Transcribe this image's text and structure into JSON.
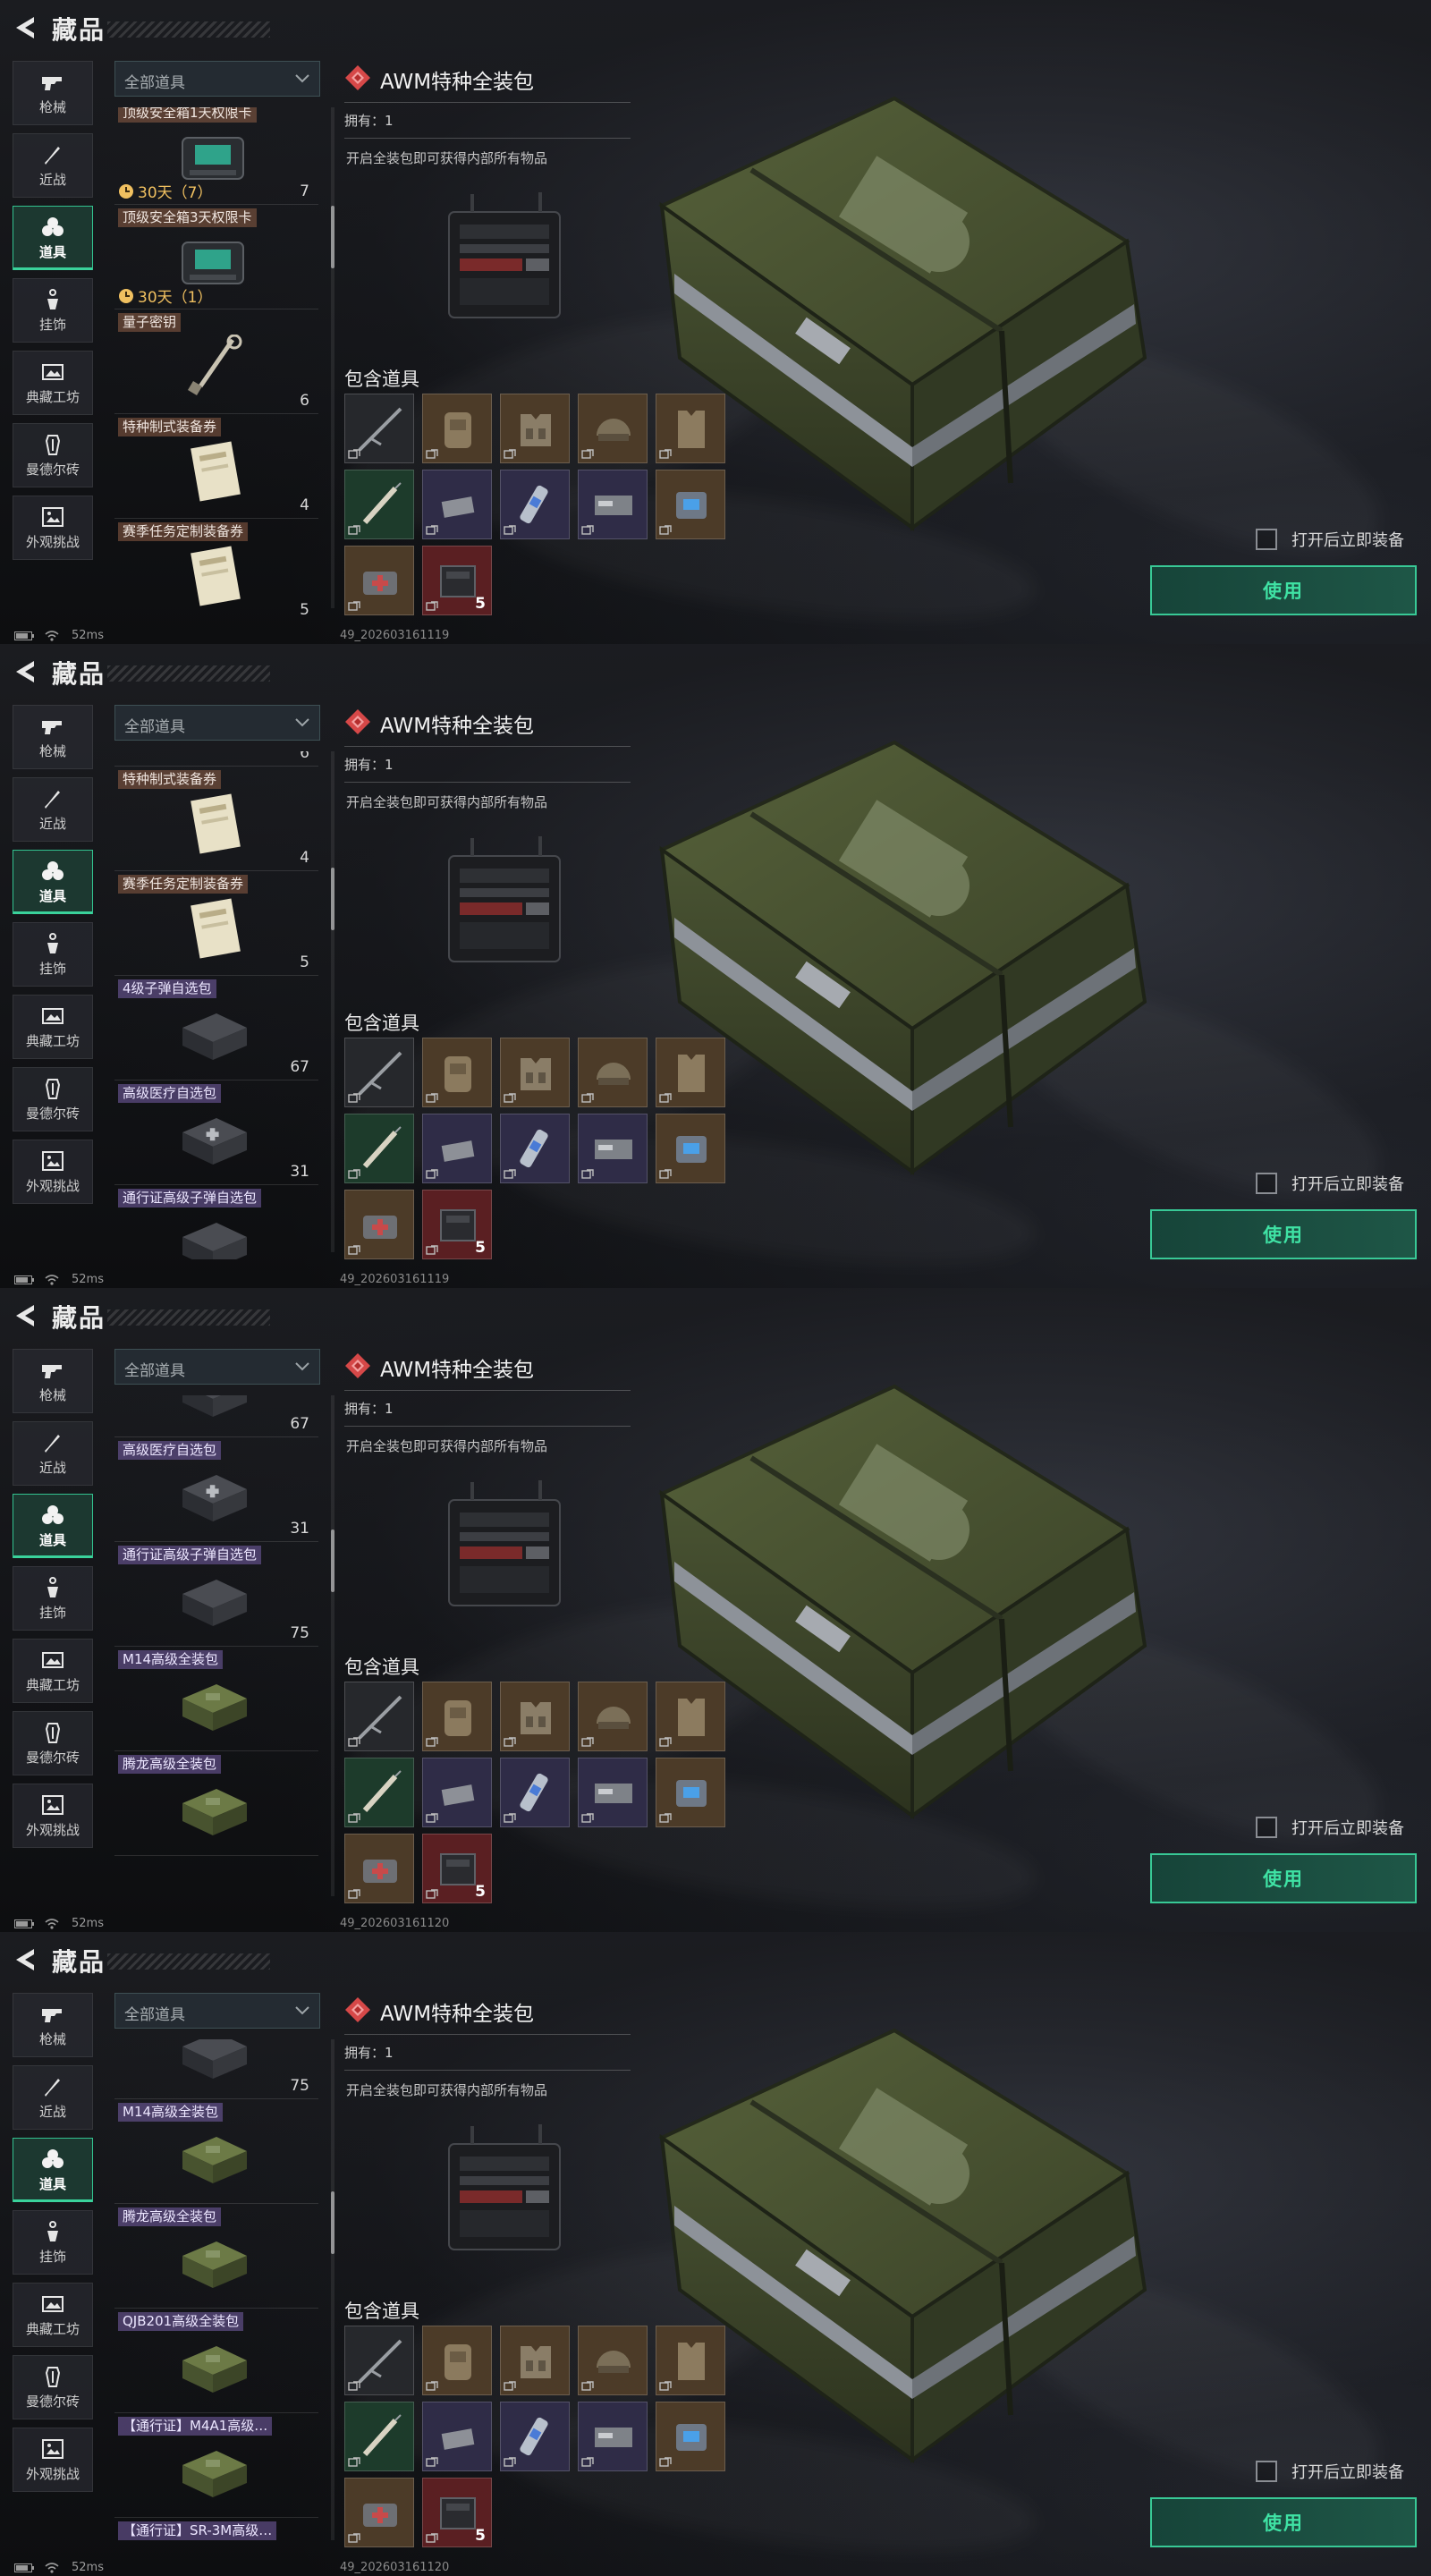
{
  "header": {
    "title": "藏品"
  },
  "nav": [
    {
      "label": "枪械",
      "icon": "gun-icon"
    },
    {
      "label": "近战",
      "icon": "knife-icon"
    },
    {
      "label": "道具",
      "icon": "grenade-icon",
      "active": true
    },
    {
      "label": "挂饰",
      "icon": "charm-icon"
    },
    {
      "label": "典藏工坊",
      "icon": "workshop-icon"
    },
    {
      "label": "曼德尔砖",
      "icon": "brick-icon"
    },
    {
      "label": "外观挑战",
      "icon": "challenge-icon"
    }
  ],
  "filter": {
    "label": "全部道具"
  },
  "detail": {
    "title": "AWM特种全装包",
    "owned": "拥有：1",
    "description": "开启全装包即可获得内部所有物品",
    "contains_title": "包含道具",
    "contained": [
      {
        "name": "sniper-rifle",
        "rarity": "gray",
        "count": ""
      },
      {
        "name": "backpack",
        "rarity": "gold",
        "count": ""
      },
      {
        "name": "chest-rig",
        "rarity": "gold",
        "count": ""
      },
      {
        "name": "helmet",
        "rarity": "gold",
        "count": ""
      },
      {
        "name": "body-armor",
        "rarity": "gold",
        "count": ""
      },
      {
        "name": "syringe",
        "rarity": "green",
        "count": ""
      },
      {
        "name": "ammo-box",
        "rarity": "purple",
        "count": ""
      },
      {
        "name": "injector",
        "rarity": "purple",
        "count": ""
      },
      {
        "name": "keycard",
        "rarity": "purple",
        "count": ""
      },
      {
        "name": "battery",
        "rarity": "gold",
        "count": ""
      },
      {
        "name": "medkit",
        "rarity": "gold",
        "count": ""
      },
      {
        "name": "ammo-crate",
        "rarity": "red",
        "count": "5"
      }
    ]
  },
  "actions": {
    "equip_label": "打开后立即装备",
    "use_label": "使用"
  },
  "status": {
    "ping": "52ms"
  },
  "frames": [
    {
      "build_id": "49_202603161119",
      "list": [
        {
          "name": "顶级安全箱1天权限卡",
          "color": "orange",
          "timer": "30天（7）",
          "count": "7",
          "art": "case"
        },
        {
          "name": "顶级安全箱3天权限卡",
          "color": "orange",
          "timer": "30天（1）",
          "count": "",
          "art": "case"
        },
        {
          "name": "量子密钥",
          "color": "orange",
          "timer": "",
          "count": "6",
          "art": "key"
        },
        {
          "name": "特种制式装备券",
          "color": "orange",
          "timer": "",
          "count": "4",
          "art": "ticket"
        },
        {
          "name": "赛季任务定制装备券",
          "color": "orange",
          "timer": "",
          "count": "5",
          "art": "ticket"
        }
      ]
    },
    {
      "build_id": "49_202603161119",
      "list": [
        {
          "name": "量子密钥",
          "color": "orange",
          "timer": "",
          "count": "6",
          "art": "key"
        },
        {
          "name": "特种制式装备券",
          "color": "orange",
          "timer": "",
          "count": "4",
          "art": "ticket"
        },
        {
          "name": "赛季任务定制装备券",
          "color": "orange",
          "timer": "",
          "count": "5",
          "art": "ticket"
        },
        {
          "name": "4级子弹自选包",
          "color": "purple",
          "timer": "",
          "count": "67",
          "art": "box"
        },
        {
          "name": "高级医疗自选包",
          "color": "purple",
          "timer": "",
          "count": "31",
          "art": "medbox"
        },
        {
          "name": "通行证高级子弹自选包",
          "color": "purple",
          "timer": "",
          "count": "",
          "art": "box"
        }
      ]
    },
    {
      "build_id": "49_202603161120",
      "list": [
        {
          "name": "4级子弹自选包",
          "color": "purple",
          "timer": "",
          "count": "67",
          "art": "box"
        },
        {
          "name": "高级医疗自选包",
          "color": "purple",
          "timer": "",
          "count": "31",
          "art": "medbox"
        },
        {
          "name": "通行证高级子弹自选包",
          "color": "purple",
          "timer": "",
          "count": "75",
          "art": "box"
        },
        {
          "name": "M14高级全装包",
          "color": "purple",
          "timer": "",
          "count": "",
          "art": "crate"
        },
        {
          "name": "腾龙高级全装包",
          "color": "purple",
          "timer": "",
          "count": "",
          "art": "crate"
        }
      ]
    },
    {
      "build_id": "49_202603161120",
      "list": [
        {
          "name": "通行证高级子弹自选包",
          "color": "purple",
          "timer": "",
          "count": "75",
          "art": "box"
        },
        {
          "name": "M14高级全装包",
          "color": "purple",
          "timer": "",
          "count": "",
          "art": "crate"
        },
        {
          "name": "腾龙高级全装包",
          "color": "purple",
          "timer": "",
          "count": "",
          "art": "crate"
        },
        {
          "name": "QJB201高级全装包",
          "color": "purple",
          "timer": "",
          "count": "",
          "art": "crate"
        },
        {
          "name": "【通行证】M4A1高级…",
          "color": "purple",
          "timer": "",
          "count": "",
          "art": "crate"
        },
        {
          "name": "【通行证】SR-3M高级…",
          "color": "purple",
          "timer": "",
          "count": "",
          "art": "crate"
        }
      ]
    }
  ]
}
